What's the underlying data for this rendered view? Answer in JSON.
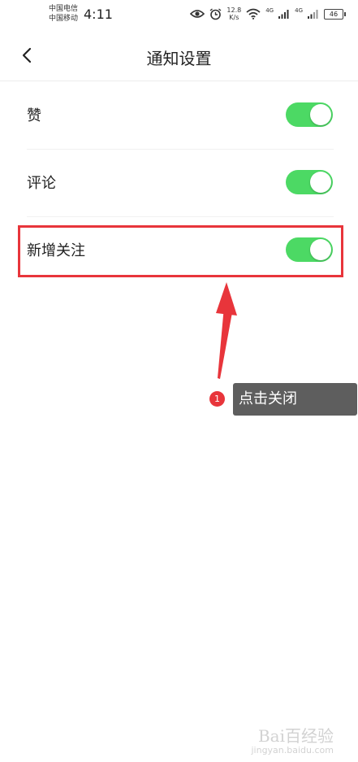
{
  "status_bar": {
    "carrier_1": "中国电信",
    "carrier_2": "中国移动",
    "time": "4:11",
    "speed_value": "12.8",
    "speed_unit": "K/s",
    "net_1": "4G",
    "net_2": "4G",
    "battery": "46",
    "icons": [
      "eye-icon",
      "alarm-icon",
      "wifi-icon",
      "signal-icon",
      "battery-icon"
    ]
  },
  "header": {
    "title": "通知设置",
    "back_icon": "chevron-left-icon"
  },
  "settings": [
    {
      "label": "赞",
      "enabled": true
    },
    {
      "label": "评论",
      "enabled": true
    },
    {
      "label": "新增关注",
      "enabled": true
    }
  ],
  "annotation": {
    "step_number": "1",
    "text": "点击关闭",
    "color": "#e8353b"
  },
  "watermark": {
    "logo": "Bai百经验",
    "url": "jingyan.baidu.com"
  },
  "colors": {
    "toggle_on": "#4cd964",
    "highlight": "#e8353b",
    "tooltip_bg": "#5e5e5e"
  }
}
